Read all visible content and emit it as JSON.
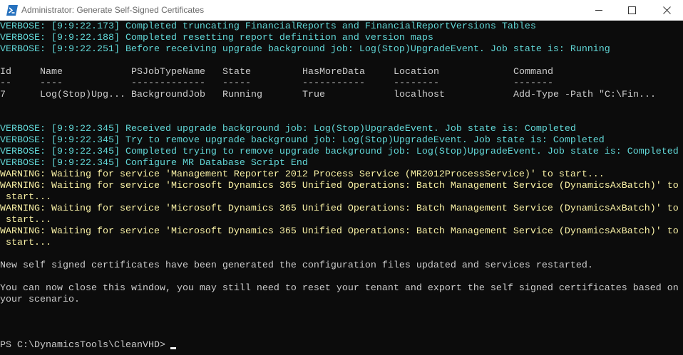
{
  "window": {
    "title": "Administrator: Generate Self-Signed Certificates"
  },
  "console": {
    "verbose_top": [
      "VERBOSE: [9:9:22.173] Completed truncating FinancialReports and FinancialReportVersions Tables",
      "VERBOSE: [9:9:22.188] Completed resetting report definition and version maps",
      "VERBOSE: [9:9:22.251] Before receiving upgrade background job: Log(Stop)UpgradeEvent. Job state is: Running"
    ],
    "job_table": {
      "headers": [
        "Id",
        "Name",
        "PSJobTypeName",
        "State",
        "HasMoreData",
        "Location",
        "Command"
      ],
      "separators": [
        "--",
        "----",
        "-------------",
        "-----",
        "-----------",
        "--------",
        "-------"
      ],
      "row": [
        "7",
        "Log(Stop)Upg...",
        "BackgroundJob",
        "Running",
        "True",
        "localhost",
        "Add-Type -Path \"C:\\Fin..."
      ]
    },
    "verbose_bottom": [
      "VERBOSE: [9:9:22.345] Received upgrade background job: Log(Stop)UpgradeEvent. Job state is: Completed",
      "VERBOSE: [9:9:22.345] Try to remove upgrade background job: Log(Stop)UpgradeEvent. Job state is: Completed",
      "VERBOSE: [9:9:22.345] Completed trying to remove upgrade background job: Log(Stop)UpgradeEvent. Job state is: Completed",
      "VERBOSE: [9:9:22.345] Configure MR Database Script End"
    ],
    "warnings": [
      "WARNING: Waiting for service 'Management Reporter 2012 Process Service (MR2012ProcessService)' to start...",
      "WARNING: Waiting for service 'Microsoft Dynamics 365 Unified Operations: Batch Management Service (DynamicsAxBatch)' to",
      " start...",
      "WARNING: Waiting for service 'Microsoft Dynamics 365 Unified Operations: Batch Management Service (DynamicsAxBatch)' to",
      " start...",
      "WARNING: Waiting for service 'Microsoft Dynamics 365 Unified Operations: Batch Management Service (DynamicsAxBatch)' to",
      " start..."
    ],
    "messages": [
      "New self signed certificates have been generated the configuration files updated and services restarted.",
      "You can now close this window, you may still need to reset your tenant and export the self signed certificates based on",
      "your scenario."
    ],
    "prompt": "PS C:\\DynamicsTools\\CleanVHD> "
  },
  "colors": {
    "background": "#0c0c0c",
    "verbose": "#61d6d6",
    "warning": "#f9f1a5",
    "text": "#cccccc"
  },
  "icons": {
    "app": "powershell-icon",
    "minimize": "minimize-icon",
    "maximize": "maximize-icon",
    "close": "close-icon"
  }
}
